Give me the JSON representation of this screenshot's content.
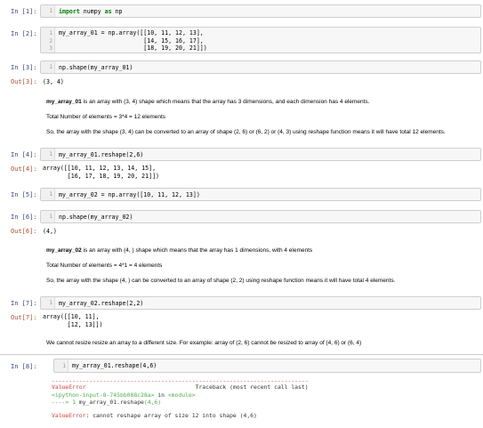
{
  "cells": {
    "c1": {
      "prompt": "In [1]:",
      "lines": [
        "1"
      ],
      "code_kw": "import",
      "code_rest1": " numpy ",
      "code_kw2": "as",
      "code_rest2": " np"
    },
    "c2": {
      "prompt": "In [2]:",
      "lines": [
        "1",
        "2",
        "3"
      ],
      "code": [
        "my_array_01 = np.array([[10, 11, 12, 13],",
        "                        [14, 15, 16, 17],",
        "                        [18, 19, 20, 21]])"
      ]
    },
    "c3": {
      "prompt": "In [3]:",
      "lines": [
        "1"
      ],
      "code": "np.shape(my_array_01)",
      "out_prompt": "Out[3]:",
      "output": "(3, 4)"
    },
    "md1": {
      "name": "my_array_01",
      "line1_rest": " is an array with (3, 4) shape which means that the array has 3 dimensions, and each dimension has 4 elements.",
      "line2": "Total Number of elements = 3*4 = 12 elements",
      "line3": "So, the array with the shape (3, 4) can be converted to an array of shape (2, 6) or (6, 2) or (4, 3) using reshape function means it will have total 12 elements."
    },
    "c4": {
      "prompt": "In [4]:",
      "lines": [
        "1"
      ],
      "code": "my_array_01.reshape(2,6)",
      "out_prompt": "Out[4]:",
      "output": [
        "array([[10, 11, 12, 13, 14, 15],",
        "       [16, 17, 18, 19, 20, 21]])"
      ]
    },
    "c5": {
      "prompt": "In [5]:",
      "lines": [
        "1"
      ],
      "code": "my_array_02 = np.array([10, 11, 12, 13])"
    },
    "c6": {
      "prompt": "In [6]:",
      "lines": [
        "1"
      ],
      "code": "np.shape(my_array_02)",
      "out_prompt": "Out[6]:",
      "output": "(4,)"
    },
    "md2": {
      "name": "my_array_02",
      "line1_rest": " is an array with (4, ) shape which means that the array has 1 dimensions, with 4 elements",
      "line2": "Total Number of elements = 4*1 = 4 elements",
      "line3": "So, the array with the shape (4, ) can be converted to an array of shape (2, 2) using reshape function means it will have total 4 elements."
    },
    "c7": {
      "prompt": "In [7]:",
      "lines": [
        "1"
      ],
      "code": "my_array_02.reshape(2,2)",
      "out_prompt": "Out[7]:",
      "output": [
        "array([[10, 11],",
        "       [12, 13]])"
      ]
    },
    "md3": {
      "text": "We cannot resize resize an array to a different size. For example: array of (2, 6) cannot be resized to array of (4, 6) or (6, 4)"
    },
    "c8": {
      "prompt": "In [8]:",
      "lines": [
        "1"
      ],
      "code": "my_array_01.reshape(4,6)",
      "error": {
        "dashes": "---------------------------------------------------------------------------",
        "etype": "ValueError",
        "tb_header": "                                Traceback (most recent call last)",
        "input_ref": "<ipython-input-8-745bb088c28a>",
        "in_word": " in ",
        "module": "<module>",
        "arrow": "----> 1 ",
        "arrow_code": "my_array_01.reshape",
        "arrow_args": "(4,6)",
        "msg_type": "ValueError",
        "msg": ": cannot reshape array of size 12 into shape (4,6)"
      }
    }
  }
}
